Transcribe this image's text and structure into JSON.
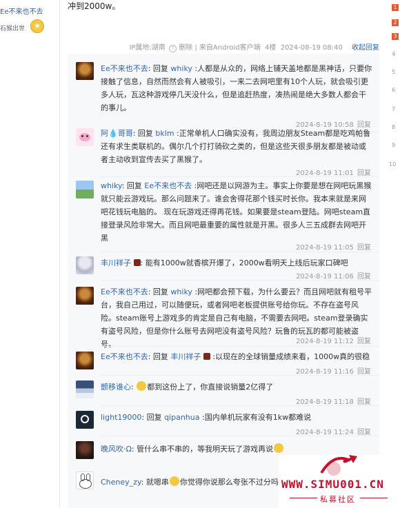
{
  "left": {
    "username": "Ee不来也不去",
    "title": "石猴出世",
    "medal": "4"
  },
  "post": {
    "text": "冲到2000w。"
  },
  "tail": {
    "ip": "IP属地:湖南",
    "delete": "删除",
    "source_prefix": "来自",
    "source": "Android客户端",
    "floor": "4楼",
    "time": "2024-08-19 08:40",
    "reply": "收起回复"
  },
  "replies": [
    {
      "user": "Ee不来也不去",
      "reply_word": "回复",
      "target": "whiky",
      "text": "人都是从众的，网络上铺天盖地都是黑神话，只要你接触了信息，自然而然会有人被吸引，一来二去网吧里有10个人玩，就会吸引更多人玩，瓦这种游戏停几天没什么，但是追赶热度，凑热闹是绝大多数人都会干的事儿。",
      "time": "2024-8-19 10:58",
      "reply": "回复",
      "avatar": "monk"
    },
    {
      "user": "阿💧哥哥",
      "reply_word": "回复",
      "target": "bklm",
      "text": "正常单机人口确实没有，我周边朋友Steam都是吃鸡帕鲁还有求生类联机的。偶尔几个打打骑砍之类的，但是这些天很多朋友都是被动或者主动收到宣传去买了黑猴了。",
      "time": "2024-8-19 11:01",
      "reply": "回复",
      "avatar": "pink"
    },
    {
      "user": "whiky",
      "reply_word": "回复",
      "target": "Ee不来也不去",
      "text": "网吧还是以网游为主。事实上你要是想在网吧玩黑猴就只能云游戏玩。那么问题来了。谁会舍得花那个钱买时长你。我本来就是来网吧花钱玩电脑的。 现在玩游戏还得再花钱。如果要是steam登陆。网吧steam直接登录风险非常大。而且网吧最重要的属性就是开黑。很多人三五成群去网吧开黑",
      "time": "2024-8-19 11:05",
      "reply": "回复",
      "avatar": "landscape"
    },
    {
      "user": "丰川祥子",
      "reply_word": "",
      "target": "",
      "text": "能有1000w就香槟开爆了，2000w看明天上线后玩家口碑吧",
      "time": "2024-8-19 11:06",
      "reply": "回复",
      "avatar": "anime"
    },
    {
      "user": "Ee不来也不去",
      "reply_word": "回复",
      "target": "whiky",
      "text": "网吧都会预下载，为什么要云？而且网吧就有租号平台，我自己用过，可以随便玩，或者网吧老板提供账号给你玩。不存在盗号风险。steam账号上游戏多的肯定是自己有电脑，不需要去网吧。steam登录确实有盗号风险，但是你什么账号去网吧没有盗号风险？玩鲁的玩瓦的都可能被盗号。",
      "time": "2024-8-19 11:12",
      "reply": "回复",
      "avatar": "monk"
    },
    {
      "user": "Ee不来也不去",
      "reply_word": "回复",
      "target": "丰川祥子",
      "text": "以现在的全球销量成绩来看，1000w真的很稳",
      "time": "2024-8-19 11:16",
      "reply": "回复",
      "avatar": "monk"
    },
    {
      "user": "颤移谁心",
      "reply_word": "",
      "target": "",
      "text": "都到这份上了，你直接说销量2亿得了",
      "time": "2024-8-19 11:18",
      "reply": "回复",
      "avatar": "sky"
    },
    {
      "user": "light19000",
      "reply_word": "回复",
      "target": "qipanhua",
      "text": "国内单机玩家有没有1kw都难说",
      "time": "2024-8-19 11:24",
      "reply": "回复",
      "avatar": "steam"
    },
    {
      "user": "晚风吹·Ω",
      "reply_word": "",
      "target": "",
      "text": "管什么串不串的，等我明天玩了游戏再说",
      "time": "",
      "reply": "",
      "avatar": "dark"
    },
    {
      "user": "Cheney_zy",
      "reply_word": "",
      "target": "",
      "text": "就嗯串",
      "text2": "你觉得你说那么夸张不过分吗",
      "time": "",
      "reply": "",
      "avatar": "rabbit"
    }
  ],
  "right_ranks": [
    "1",
    "2",
    "3",
    "4",
    "5",
    "6",
    "7",
    "8",
    "9",
    "10"
  ],
  "watermark": {
    "site": "WWW.SIMU001.CN",
    "sub": "私募社区"
  }
}
